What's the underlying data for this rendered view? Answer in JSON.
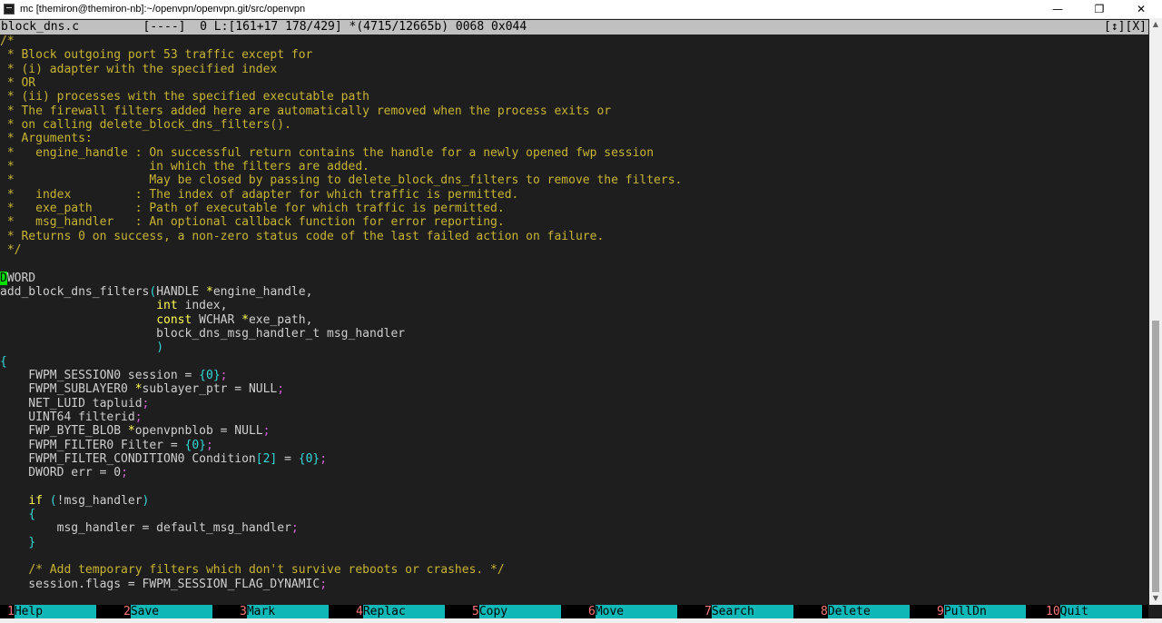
{
  "window": {
    "title": "mc [themiron@themiron-nb]:~/openvpn/openvpn.git/src/openvpn",
    "minimize": "—",
    "maximize": "❐",
    "close": "✕"
  },
  "status": {
    "text": "block_dns.c         [----]  0 L:[161+17 178/429] *(4715/12665b) 0068 0x044",
    "right": "[↕][X]"
  },
  "code_lines": [
    [
      [
        "c",
        "/*"
      ]
    ],
    [
      [
        "c",
        " * Block outgoing port 53 traffic except for"
      ]
    ],
    [
      [
        "c",
        " * (i) adapter with the specified index"
      ]
    ],
    [
      [
        "c",
        " * OR"
      ]
    ],
    [
      [
        "c",
        " * (ii) processes with the specified executable path"
      ]
    ],
    [
      [
        "c",
        " * The firewall filters added here are automatically removed when the process exits or"
      ]
    ],
    [
      [
        "c",
        " * on calling delete_block_dns_filters()."
      ]
    ],
    [
      [
        "c",
        " * Arguments:"
      ]
    ],
    [
      [
        "c",
        " *   engine_handle : On successful return contains the handle for a newly opened fwp session"
      ]
    ],
    [
      [
        "c",
        " *                   in which the filters are added."
      ]
    ],
    [
      [
        "c",
        " *                   May be closed by passing to delete_block_dns_filters to remove the filters."
      ]
    ],
    [
      [
        "c",
        " *   index         : The index of adapter for which traffic is permitted."
      ]
    ],
    [
      [
        "c",
        " *   exe_path      : Path of executable for which traffic is permitted."
      ]
    ],
    [
      [
        "c",
        " *   msg_handler   : An optional callback function for error reporting."
      ]
    ],
    [
      [
        "c",
        " * Returns 0 on success, a non-zero status code of the last failed action on failure."
      ]
    ],
    [
      [
        "c",
        " */"
      ]
    ],
    [
      [
        "n",
        ""
      ]
    ],
    [
      [
        "cursor",
        "D"
      ],
      [
        "n",
        "WORD"
      ]
    ],
    [
      [
        "n",
        "add_block_dns_filters"
      ],
      [
        "b",
        "("
      ],
      [
        "n",
        "HANDLE "
      ],
      [
        "k",
        "*"
      ],
      [
        "n",
        "engine_handle,"
      ]
    ],
    [
      [
        "n",
        "                      "
      ],
      [
        "k",
        "int"
      ],
      [
        "n",
        " index,"
      ]
    ],
    [
      [
        "n",
        "                      "
      ],
      [
        "k",
        "const"
      ],
      [
        "n",
        " WCHAR "
      ],
      [
        "k",
        "*"
      ],
      [
        "n",
        "exe_path,"
      ]
    ],
    [
      [
        "n",
        "                      block_dns_msg_handler_t msg_handler"
      ]
    ],
    [
      [
        "n",
        "                      "
      ],
      [
        "b",
        ")"
      ]
    ],
    [
      [
        "b",
        "{"
      ]
    ],
    [
      [
        "n",
        "    FWPM_SESSION0 session = "
      ],
      [
        "b",
        "{"
      ],
      [
        "b",
        "0"
      ],
      [
        "b",
        "}"
      ],
      [
        "p",
        ";"
      ]
    ],
    [
      [
        "n",
        "    FWPM_SUBLAYER0 "
      ],
      [
        "k",
        "*"
      ],
      [
        "n",
        "sublayer_ptr = NULL"
      ],
      [
        "p",
        ";"
      ]
    ],
    [
      [
        "n",
        "    NET_LUID tapluid"
      ],
      [
        "p",
        ";"
      ]
    ],
    [
      [
        "n",
        "    UINT64 filterid"
      ],
      [
        "p",
        ";"
      ]
    ],
    [
      [
        "n",
        "    FWP_BYTE_BLOB "
      ],
      [
        "k",
        "*"
      ],
      [
        "n",
        "openvpnblob = NULL"
      ],
      [
        "p",
        ";"
      ]
    ],
    [
      [
        "n",
        "    FWPM_FILTER0 Filter = "
      ],
      [
        "b",
        "{"
      ],
      [
        "b",
        "0"
      ],
      [
        "b",
        "}"
      ],
      [
        "p",
        ";"
      ]
    ],
    [
      [
        "n",
        "    FWPM_FILTER_CONDITION0 Condition"
      ],
      [
        "b",
        "["
      ],
      [
        "b",
        "2"
      ],
      [
        "b",
        "]"
      ],
      [
        "n",
        " = "
      ],
      [
        "b",
        "{"
      ],
      [
        "b",
        "0"
      ],
      [
        "b",
        "}"
      ],
      [
        "p",
        ";"
      ]
    ],
    [
      [
        "n",
        "    DWORD err = 0"
      ],
      [
        "p",
        ";"
      ]
    ],
    [
      [
        "n",
        ""
      ]
    ],
    [
      [
        "n",
        "    "
      ],
      [
        "k",
        "if"
      ],
      [
        "n",
        " "
      ],
      [
        "b",
        "("
      ],
      [
        "n",
        "!msg_handler"
      ],
      [
        "b",
        ")"
      ]
    ],
    [
      [
        "n",
        "    "
      ],
      [
        "b",
        "{"
      ]
    ],
    [
      [
        "n",
        "        msg_handler = default_msg_handler"
      ],
      [
        "p",
        ";"
      ]
    ],
    [
      [
        "n",
        "    "
      ],
      [
        "b",
        "}"
      ]
    ],
    [
      [
        "n",
        ""
      ]
    ],
    [
      [
        "n",
        "    "
      ],
      [
        "c",
        "/* Add temporary filters which don't survive reboots or crashes. */"
      ]
    ],
    [
      [
        "n",
        "    session.flags = FWPM_SESSION_FLAG_DYNAMIC"
      ],
      [
        "p",
        ";"
      ]
    ]
  ],
  "fkeys": [
    {
      "num": "1",
      "label": "Help"
    },
    {
      "num": "2",
      "label": "Save"
    },
    {
      "num": "3",
      "label": "Mark"
    },
    {
      "num": "4",
      "label": "Replac"
    },
    {
      "num": "5",
      "label": "Copy"
    },
    {
      "num": "6",
      "label": "Move"
    },
    {
      "num": "7",
      "label": "Search"
    },
    {
      "num": "8",
      "label": "Delete"
    },
    {
      "num": "9",
      "label": "PullDn"
    },
    {
      "num": "10",
      "label": "Quit"
    }
  ],
  "colors": {
    "comment": "#c8b432",
    "keyword": "#ffff55",
    "bracket": "#33d8d8",
    "punct": "#d060d0",
    "fkey_bg": "#0fb7b7",
    "fkey_num": "#ff7777",
    "cursor": "#00e000"
  }
}
